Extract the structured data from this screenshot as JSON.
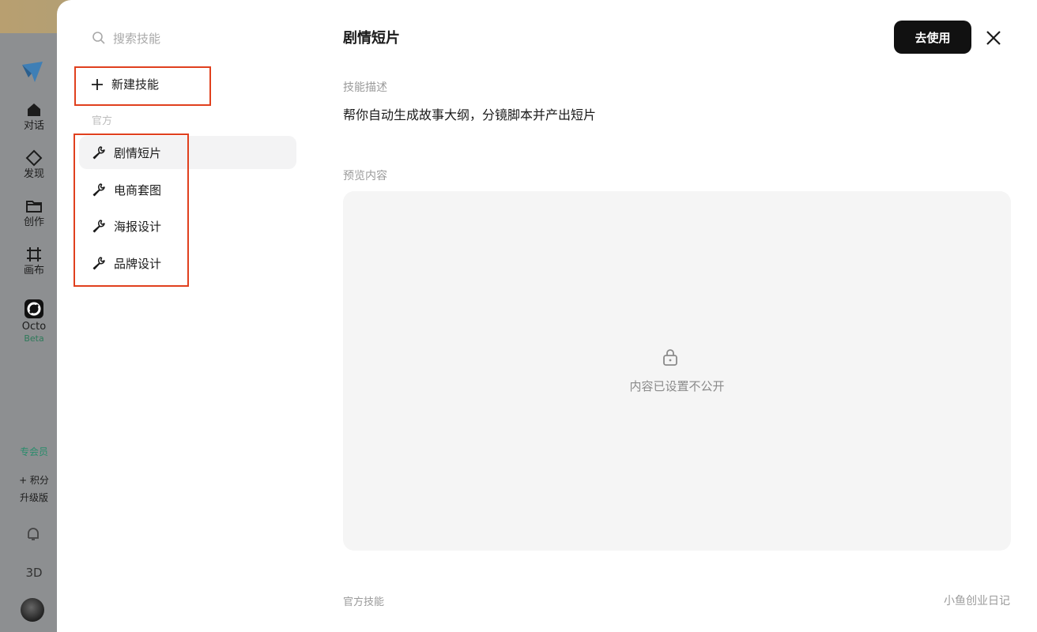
{
  "rail": {
    "items": [
      {
        "label": "对话",
        "icon": "home-icon"
      },
      {
        "label": "发现",
        "icon": "diamond-icon"
      },
      {
        "label": "创作",
        "icon": "folder-icon"
      },
      {
        "label": "画布",
        "icon": "canvas-icon"
      },
      {
        "label": "Octo",
        "icon": "octo-icon",
        "badge": "Beta"
      }
    ],
    "vip": "专会员",
    "upgrade_line1": "+ 积分",
    "upgrade_line2": "升级版",
    "threed": "3D"
  },
  "sidebar": {
    "search_placeholder": "搜索技能",
    "new_skill": "新建技能",
    "section_label": "官方",
    "skills": [
      "剧情短片",
      "电商套图",
      "海报设计",
      "品牌设计"
    ],
    "active_index": 0
  },
  "detail": {
    "title": "剧情短片",
    "use_button": "去使用",
    "desc_label": "技能描述",
    "description": "帮你自动生成故事大纲，分镜脚本并产出短片",
    "preview_label": "预览内容",
    "locked_text": "内容已设置不公开",
    "footer_left": "官方技能",
    "footer_right": "小鱼创业日记"
  },
  "colors": {
    "highlight_box": "#e0401e",
    "button_bg": "#111111",
    "active_item_bg": "#f3f3f4",
    "preview_bg": "#f5f5f5"
  }
}
